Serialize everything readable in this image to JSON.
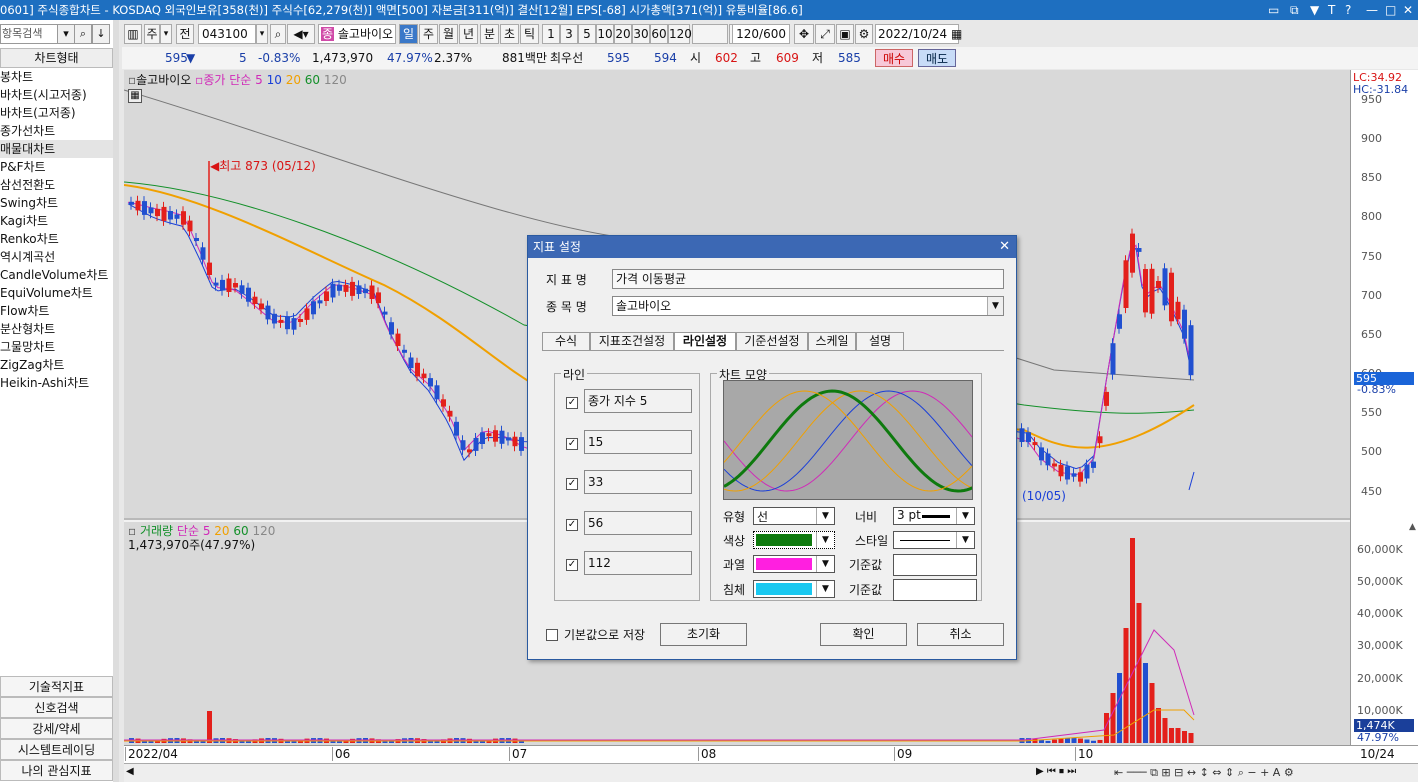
{
  "title": "0601] 주식종합차트 - KOSDAQ 외국인보유[358(천)] 주식수[62,279(천)] 액면[500] 자본금[311(억)] 결산[12월] EPS[-68] 시가총액[371(억)] 유통비율[86.6]",
  "sidebar": {
    "search_placeholder": "항목검색",
    "header": "차트형태",
    "items": [
      "봉차트",
      "바차트(시고저종)",
      "바차트(고저종)",
      "종가선차트",
      "매물대차트",
      "P&F차트",
      "삼선전환도",
      "Swing차트",
      "Kagi차트",
      "Renko차트",
      "역시계곡선",
      "CandleVolume차트",
      "EquiVolume차트",
      "Flow차트",
      "분산형차트",
      "그물망차트",
      "ZigZag차트",
      "Heikin-Ashi차트"
    ],
    "bottom": [
      "기술적지표",
      "신호검색",
      "강세/약세",
      "시스템트레이딩",
      "나의 관심지표"
    ]
  },
  "toolbar": {
    "period_label": "주",
    "prev_label": "전",
    "code": "043100",
    "stock_name": "솔고바이오",
    "units": [
      "일",
      "주",
      "월",
      "년",
      "분",
      "초",
      "틱"
    ],
    "numbers": [
      "1",
      "3",
      "5",
      "10",
      "20",
      "30",
      "60",
      "120"
    ],
    "count": "120/600",
    "date": "2022/10/24"
  },
  "info": {
    "price": "595",
    "change": "5",
    "pct": "-0.83%",
    "volume": "1,473,970",
    "vol_pct": "47.97%",
    "turn": "2.37%",
    "amount": "881백만",
    "bid_label": "최우선",
    "bid1": "595",
    "bid2": "594",
    "open_label": "시",
    "open": "602",
    "high_label": "고",
    "high": "609",
    "low_label": "저",
    "low": "585",
    "buy": "매수",
    "sell": "매도"
  },
  "chart_legend": {
    "name": "솔고바이오",
    "ma_label": "종가 단순 5",
    "ma": [
      "10",
      "20",
      "60",
      "120"
    ],
    "max_annot": "최고 873 (05/12)",
    "min_annot": "(10/05)"
  },
  "volume_legend": {
    "label": "거래량",
    "ma_label": "단순 5",
    "ma": [
      "20",
      "60",
      "120"
    ],
    "value": "1,473,970주(47.97%)"
  },
  "yaxis": {
    "lc": "LC:34.92",
    "hc": "HC:-31.84",
    "ticks": [
      "950",
      "900",
      "850",
      "800",
      "750",
      "700",
      "650",
      "600",
      "550",
      "500",
      "450"
    ],
    "cur_price": "595",
    "cur_pct": "-0.83%",
    "vol_ticks": [
      "60,000K",
      "50,000K",
      "40,000K",
      "30,000K",
      "20,000K",
      "10,000K"
    ],
    "cur_vol": "1,474K",
    "cur_vol_pct": "47.97%"
  },
  "xaxis": {
    "labels": [
      "2022/04",
      "06",
      "07",
      "08",
      "09",
      "10"
    ],
    "right": "10/24"
  },
  "dialog": {
    "title": "지표 설정",
    "indicator_label": "지 표 명",
    "indicator_value": "가격 이동평균",
    "stock_label": "종 목 명",
    "stock_value": "솔고바이오",
    "tabs": [
      "수식",
      "지표조건설정",
      "라인설정",
      "기준선설정",
      "스케일",
      "설명"
    ],
    "line_group": "라인",
    "lines": [
      "종가 지수 5",
      "15",
      "33",
      "56",
      "112"
    ],
    "shape_group": "차트 모양",
    "type_label": "유형",
    "type_value": "선",
    "width_label": "너비",
    "width_value": "3 pt",
    "color_label": "색상",
    "style_label": "스타일",
    "over_label": "과열",
    "base_label1": "기준값",
    "under_label": "침체",
    "base_label2": "기준값",
    "save_default": "기본값으로 저장",
    "reset": "초기화",
    "ok": "확인",
    "cancel": "취소",
    "colors": {
      "line": "#0e7a0e",
      "over": "#ff1fe0",
      "under": "#19c8f0"
    }
  }
}
